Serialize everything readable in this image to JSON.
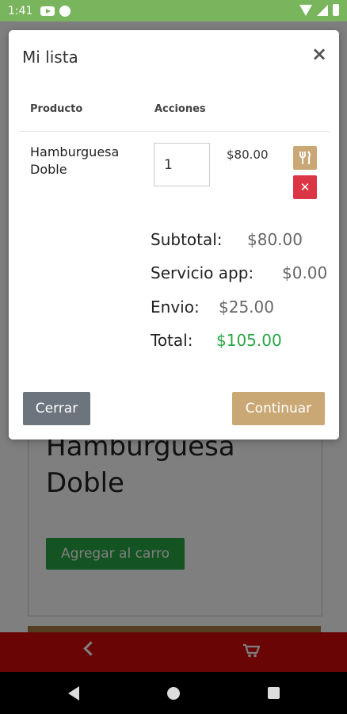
{
  "status_bar": {
    "time": "1:41"
  },
  "modal": {
    "title": "Mi lista",
    "close_glyph": "×",
    "columns": {
      "product": "Producto",
      "actions": "Acciones"
    },
    "item": {
      "name": "Hamburguesa Doble",
      "quantity": "1",
      "price": "$80.00",
      "remove_glyph": "✕"
    },
    "summary": {
      "subtotal_label": "Subtotal:",
      "subtotal_value": "$80.00",
      "service_label": "Servicio app:",
      "service_value": "$0.00",
      "shipping_label": "Envio:",
      "shipping_value": "$25.00",
      "total_label": "Total:",
      "total_value": "$105.00"
    },
    "buttons": {
      "close": "Cerrar",
      "continue": "Continuar"
    }
  },
  "background": {
    "product_name": "Hamburguesa Doble",
    "add_to_cart": "Agregar al carro"
  },
  "colors": {
    "status_bar": "#79b55c",
    "accent": "#c9a875",
    "danger": "#dc3545",
    "success": "#28a745",
    "bottom_nav": "#d40b0b"
  },
  "icons": [
    "youtube-icon",
    "app-icon",
    "wifi-icon",
    "signal-icon",
    "battery-icon",
    "utensils-icon",
    "remove-icon",
    "back-chevron-icon",
    "cart-icon",
    "nav-back-icon",
    "nav-home-icon",
    "nav-recents-icon"
  ]
}
